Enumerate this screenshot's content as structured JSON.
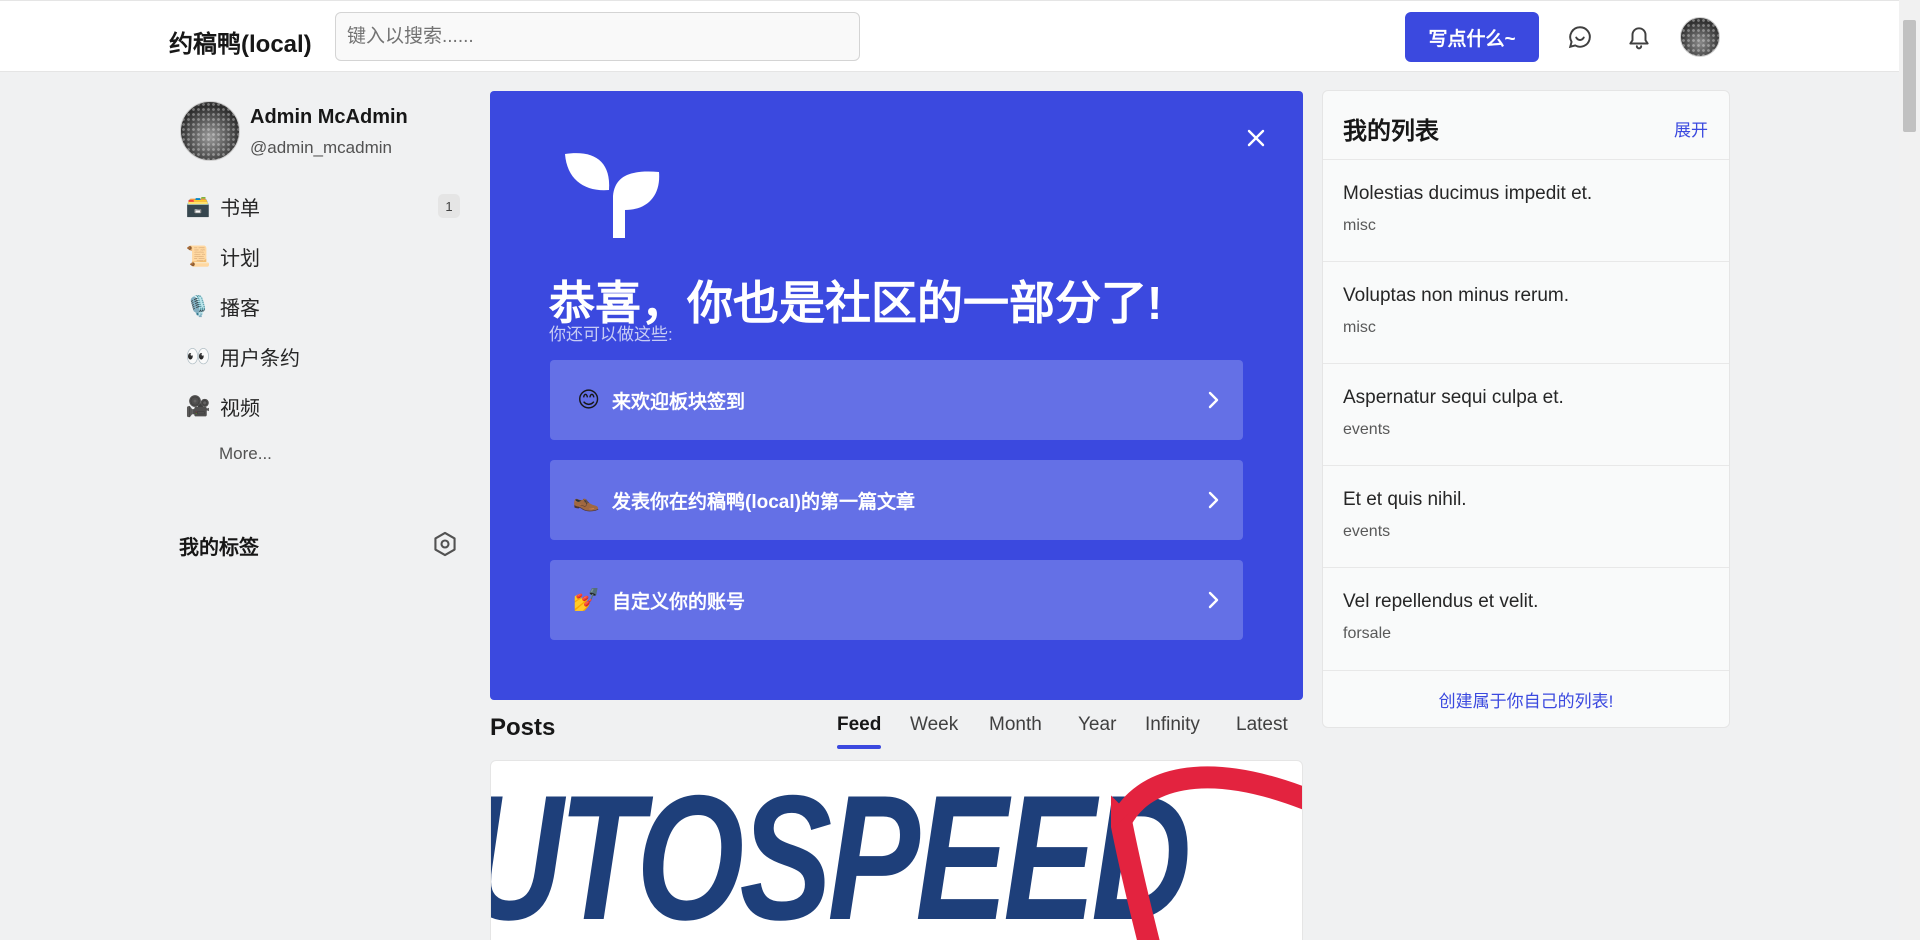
{
  "header": {
    "logo": "约稿鸭(local)",
    "search_placeholder": "键入以搜索......",
    "write_label": "写点什么~",
    "icons": [
      "chat-icon",
      "bell-icon",
      "avatar"
    ]
  },
  "user": {
    "name": "Admin McAdmin",
    "handle": "@admin_mcadmin"
  },
  "sidebar": {
    "items": [
      {
        "emoji": "🗃️",
        "label": "书单",
        "badge": "1"
      },
      {
        "emoji": "📜",
        "label": "计划"
      },
      {
        "emoji": "🎙️",
        "label": "播客"
      },
      {
        "emoji": "👀",
        "label": "用户条约"
      },
      {
        "emoji": "🎥",
        "label": "视频"
      }
    ],
    "more": "More..."
  },
  "tags": {
    "title": "我的标签"
  },
  "banner": {
    "title": "恭喜，你也是社区的一部分了!",
    "subtitle": "你还可以做这些:",
    "actions": [
      {
        "emoji": "😊",
        "label": "来欢迎板块签到"
      },
      {
        "emoji": "👞",
        "label": "发表你在约稿鸭(local)的第一篇文章"
      },
      {
        "emoji": "💅",
        "label": "自定义你的账号"
      }
    ]
  },
  "posts": {
    "title": "Posts",
    "tabs": [
      "Feed",
      "Week",
      "Month",
      "Year",
      "Infinity",
      "Latest"
    ],
    "active_tab": "Feed",
    "cover_text": "UTOSPEED"
  },
  "lists": {
    "title": "我的列表",
    "expand": "展开",
    "items": [
      {
        "title": "Molestias ducimus impedit et.",
        "tag": "misc"
      },
      {
        "title": "Voluptas non minus rerum.",
        "tag": "misc"
      },
      {
        "title": "Aspernatur sequi culpa et.",
        "tag": "events"
      },
      {
        "title": "Et et quis nihil.",
        "tag": "events"
      },
      {
        "title": "Vel repellendus et velit.",
        "tag": "forsale"
      }
    ],
    "footer": "创建属于你自己的列表!"
  },
  "colors": {
    "accent": "#3b49df",
    "action_bg": "#6470e6",
    "page_bg": "#f0f1f2"
  }
}
